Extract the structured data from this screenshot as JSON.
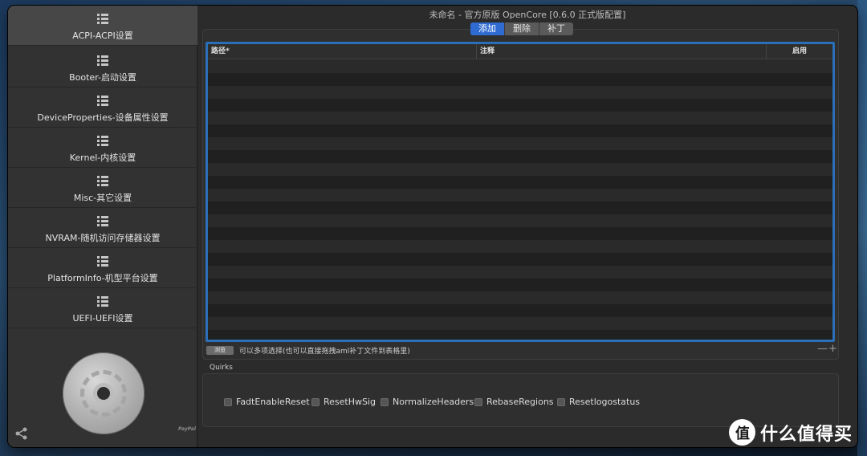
{
  "window": {
    "title": "未命名 - 官方原版 OpenCore [0.6.0 正式版配置]"
  },
  "sidebar": {
    "items": [
      {
        "label": "ACPI-ACPI设置",
        "icon": "list-icon",
        "active": true
      },
      {
        "label": "Booter-启动设置",
        "icon": "list-icon"
      },
      {
        "label": "DeviceProperties-设备属性设置",
        "icon": "list-icon"
      },
      {
        "label": "Kernel-内核设置",
        "icon": "list-icon"
      },
      {
        "label": "Misc-其它设置",
        "icon": "list-icon"
      },
      {
        "label": "NVRAM-随机访问存储器设置",
        "icon": "list-icon"
      },
      {
        "label": "PlatformInfo-机型平台设置",
        "icon": "list-icon"
      },
      {
        "label": "UEFI-UEFI设置",
        "icon": "list-icon"
      }
    ],
    "paypal": "PayPal"
  },
  "segments": [
    "添加",
    "删除",
    "补丁"
  ],
  "table": {
    "columns": [
      "路径*",
      "注释",
      "启用"
    ]
  },
  "browse_label": "浏览",
  "hint": "可以多项选择(也可以直接拖拽aml补丁文件到表格里)",
  "plusminus": "—+",
  "quirks": {
    "title": "Quirks",
    "items": [
      "FadtEnableReset",
      "ResetHwSig",
      "NormalizeHeaders",
      "RebaseRegions",
      "Resetlogostatus"
    ]
  },
  "watermark": {
    "badge": "值",
    "text": "什么值得买"
  },
  "colors": {
    "accent": "#2f6bd1",
    "table_border": "#2a6fb8"
  }
}
